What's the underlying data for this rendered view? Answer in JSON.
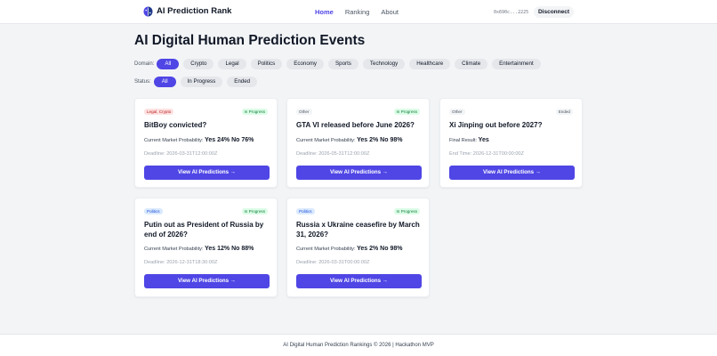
{
  "header": {
    "brand": "AI Prediction Rank",
    "nav": [
      "Home",
      "Ranking",
      "About"
    ],
    "wallet": "0x690c...2225",
    "disconnect_label": "Disconnect",
    "accent_color": "#4f46e5"
  },
  "page": {
    "title": "AI Digital Human Prediction Events"
  },
  "filters": {
    "domain_label": "Domain:",
    "domains": [
      "All",
      "Crypto",
      "Legal",
      "Politics",
      "Economy",
      "Sports",
      "Technology",
      "Healthcare",
      "Climate",
      "Entertainment"
    ],
    "domain_selected": "All",
    "status_label": "Status:",
    "statuses": [
      "All",
      "In Progress",
      "Ended"
    ],
    "status_selected": "All"
  },
  "events": [
    {
      "tag": "Legal, Crypto",
      "status": "In Progress",
      "title": "BitBoy convicted?",
      "prob_label": "Current Market Probability:",
      "prob_value": "Yes 24% No 76%",
      "deadline": "Deadline: 2026-03-31T12:00:00Z",
      "button": "View AI Predictions →"
    },
    {
      "tag": "Other",
      "status": "In Progress",
      "title": "GTA VI released before June 2026?",
      "prob_label": "Current Market Probability:",
      "prob_value": "Yes 2% No 98%",
      "deadline": "Deadline: 2026-05-31T12:00:00Z",
      "button": "View AI Predictions →"
    },
    {
      "tag": "Other",
      "status": "Ended",
      "title": "Xi Jinping out before 2027?",
      "prob_label": "Final Result:",
      "prob_value": "Yes",
      "deadline": "End Time: 2026-12-31T00:00:00Z",
      "button": "View AI Predictions →"
    },
    {
      "tag": "Politics",
      "status": "In Progress",
      "title": "Putin out as President of Russia by end of 2026?",
      "prob_label": "Current Market Probability:",
      "prob_value": "Yes 12% No 88%",
      "deadline": "Deadline: 2026-12-31T18:30:00Z",
      "button": "View AI Predictions →"
    },
    {
      "tag": "Politics",
      "status": "In Progress",
      "title": "Russia x Ukraine ceasefire by March 31, 2026?",
      "prob_label": "Current Market Probability:",
      "prob_value": "Yes 2% No 98%",
      "deadline": "Deadline: 2026-03-31T00:00:00Z",
      "button": "View AI Predictions →"
    }
  ],
  "footer": {
    "text": "AI Digital Human Prediction Rankings © 2026 | Hackathon MVP"
  }
}
